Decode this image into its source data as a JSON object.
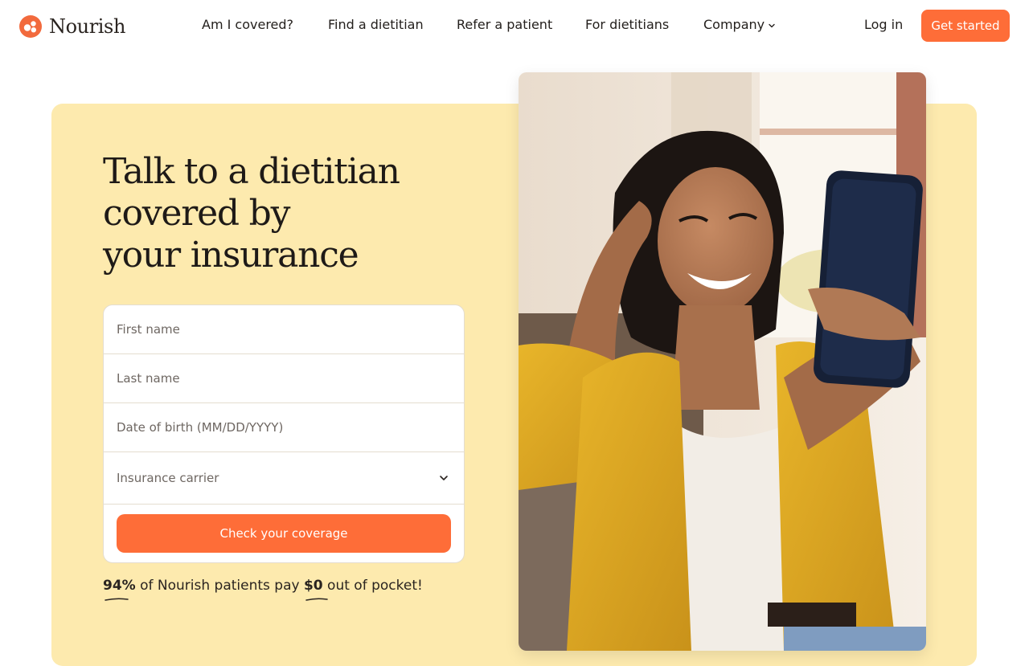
{
  "brand": {
    "name": "Nourish",
    "accent": "#fe6d38",
    "hero_bg": "#fdeaae"
  },
  "nav": {
    "items": [
      {
        "label": "Am I covered?"
      },
      {
        "label": "Find a dietitian"
      },
      {
        "label": "Refer a patient"
      },
      {
        "label": "For dietitians"
      },
      {
        "label": "Company",
        "icon": "chevron-down-icon"
      }
    ],
    "login_label": "Log in",
    "cta_label": "Get started"
  },
  "hero": {
    "headline_lines": [
      "Talk to a dietitian",
      "covered by",
      "your insurance"
    ],
    "form": {
      "first_name_placeholder": "First name",
      "last_name_placeholder": "Last name",
      "dob_placeholder": "Date of birth (MM/DD/YYYY)",
      "carrier_label": "Insurance carrier",
      "carrier_icon": "chevron-down-icon",
      "submit_label": "Check your coverage"
    },
    "stat": {
      "percent": "94%",
      "middle": " of Nourish patients pay ",
      "amount": "$0",
      "end": " out of pocket!"
    },
    "photo": {
      "subject": "smiling-woman-with-phone-photo"
    }
  }
}
